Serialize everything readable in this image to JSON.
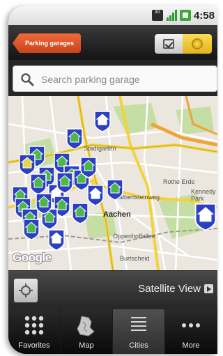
{
  "status_bar": {
    "network_label": "3G",
    "time": "4:58"
  },
  "title_bar": {
    "back_label": "Parking garages",
    "toggle_list_icon": "check-icon",
    "toggle_map_icon": "target-icon"
  },
  "search": {
    "placeholder": "Search parking garage",
    "icon": "search-icon"
  },
  "map": {
    "provider_label": "Google",
    "city_label": "Aachen",
    "street_labels": [
      "Stadtgarten",
      "Adalbertsteinweg",
      "Oppenhoffallee",
      "Rothe Erde",
      "Burtscheid",
      "Kennedy Park"
    ],
    "marker_count": 24,
    "colors": {
      "marker_blue": "#2d3fc4",
      "marker_green": "#4cb84a",
      "road_yellow": "#f4d23a",
      "park_green": "#c5dea4"
    }
  },
  "map_controls": {
    "locate_icon": "crosshair-icon",
    "satellite_label": "Satellite View"
  },
  "tabs": [
    {
      "label": "Favorites",
      "icon": "grid-icon",
      "active": false
    },
    {
      "label": "Map",
      "icon": "map-icon",
      "active": false
    },
    {
      "label": "Cities",
      "icon": "list-icon",
      "active": true
    },
    {
      "label": "More",
      "icon": "more-icon",
      "active": false
    }
  ]
}
